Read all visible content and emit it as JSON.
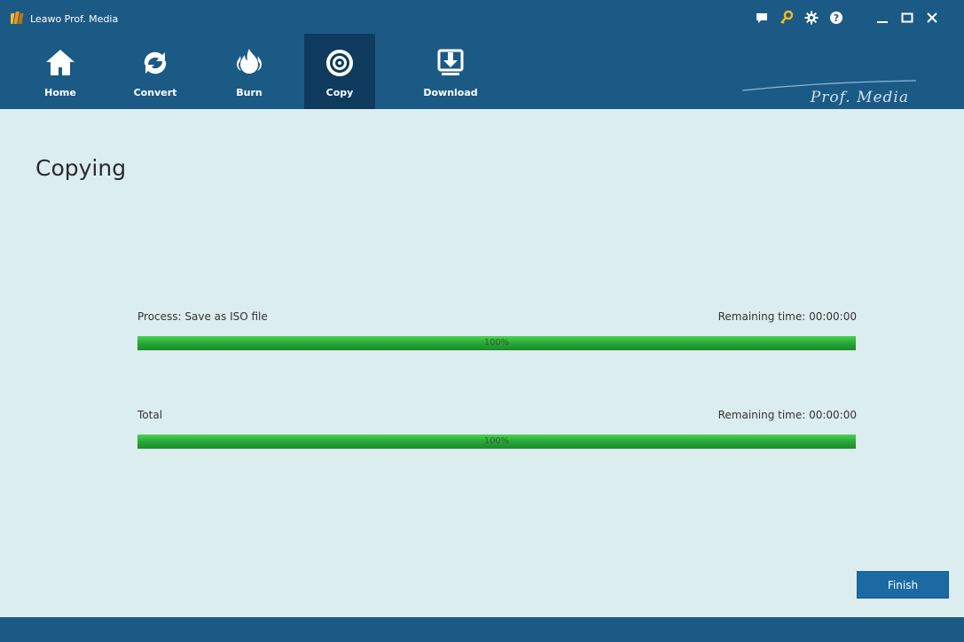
{
  "window": {
    "title": "Leawo Prof. Media",
    "icons": [
      "logo-icon",
      "feedback-icon",
      "key-icon",
      "settings-icon",
      "help-icon",
      "minimize-icon",
      "maximize-icon",
      "close-icon"
    ]
  },
  "nav": {
    "items": [
      {
        "label": "Home",
        "icon": "home-icon"
      },
      {
        "label": "Convert",
        "icon": "convert-icon"
      },
      {
        "label": "Burn",
        "icon": "burn-icon"
      },
      {
        "label": "Copy",
        "icon": "copy-icon",
        "active": true
      },
      {
        "label": "Download",
        "icon": "download-icon"
      }
    ],
    "brand": "Prof. Media"
  },
  "main": {
    "title": "Copying",
    "process": {
      "label": "Process: Save as ISO file",
      "remaining": "Remaining time: 00:00:00",
      "progress_text": "100%",
      "progress": 1.0
    },
    "total": {
      "label": "Total",
      "remaining": "Remaining time: 00:00:00",
      "progress_text": "100%",
      "progress": 1.0
    },
    "finish_label": "Finish"
  },
  "colors": {
    "header": "#1c5a86",
    "active_tab": "#0e3b5e",
    "background": "#dcedef",
    "progress_green": "#2bb03a",
    "button": "#1c6aa3"
  }
}
